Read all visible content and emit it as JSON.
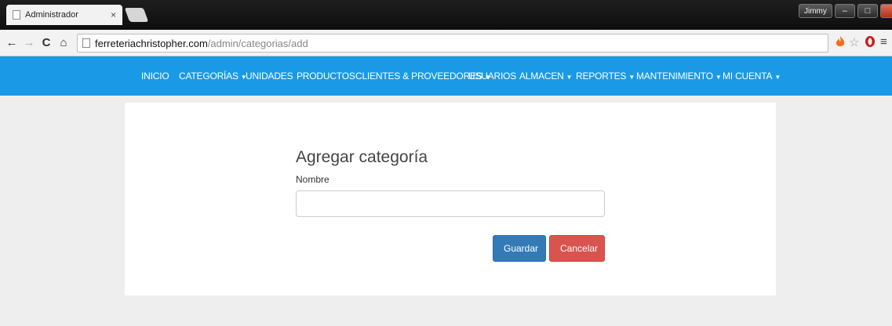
{
  "browser": {
    "tab_title": "Administrador",
    "tab_close": "×",
    "user_label": "Jimmy",
    "min": "–",
    "max": "□",
    "close": "x",
    "back": "←",
    "forward": "→",
    "reload": "C",
    "home": "⌂",
    "url_host": "ferreteriachristopher.com",
    "url_path": "/admin/categorias/add",
    "menu": "≡"
  },
  "nav": {
    "items": [
      {
        "label": "INICIO",
        "caret": ""
      },
      {
        "label": "CATEGORÍAS",
        "caret": "▼"
      },
      {
        "label": "UNIDADES",
        "caret": ""
      },
      {
        "label": "PRODUCTOS",
        "caret": ""
      },
      {
        "label": "CLIENTES & PROVEEDORES",
        "caret": "▼"
      },
      {
        "label": "USUARIOS",
        "caret": ""
      },
      {
        "label": "ALMACEN",
        "caret": "▼"
      },
      {
        "label": "REPORTES",
        "caret": "▼"
      },
      {
        "label": "MANTENIMIENTO",
        "caret": "▼"
      },
      {
        "label": "MI CUENTA",
        "caret": "▼"
      }
    ]
  },
  "form": {
    "title": "Agregar categoría",
    "name_label": "Nombre",
    "name_value": "",
    "save_label": "Guardar",
    "cancel_label": "Cancelar"
  },
  "colors": {
    "navbar": "#1a9ae6",
    "save": "#337ab7",
    "cancel": "#d9534f"
  }
}
